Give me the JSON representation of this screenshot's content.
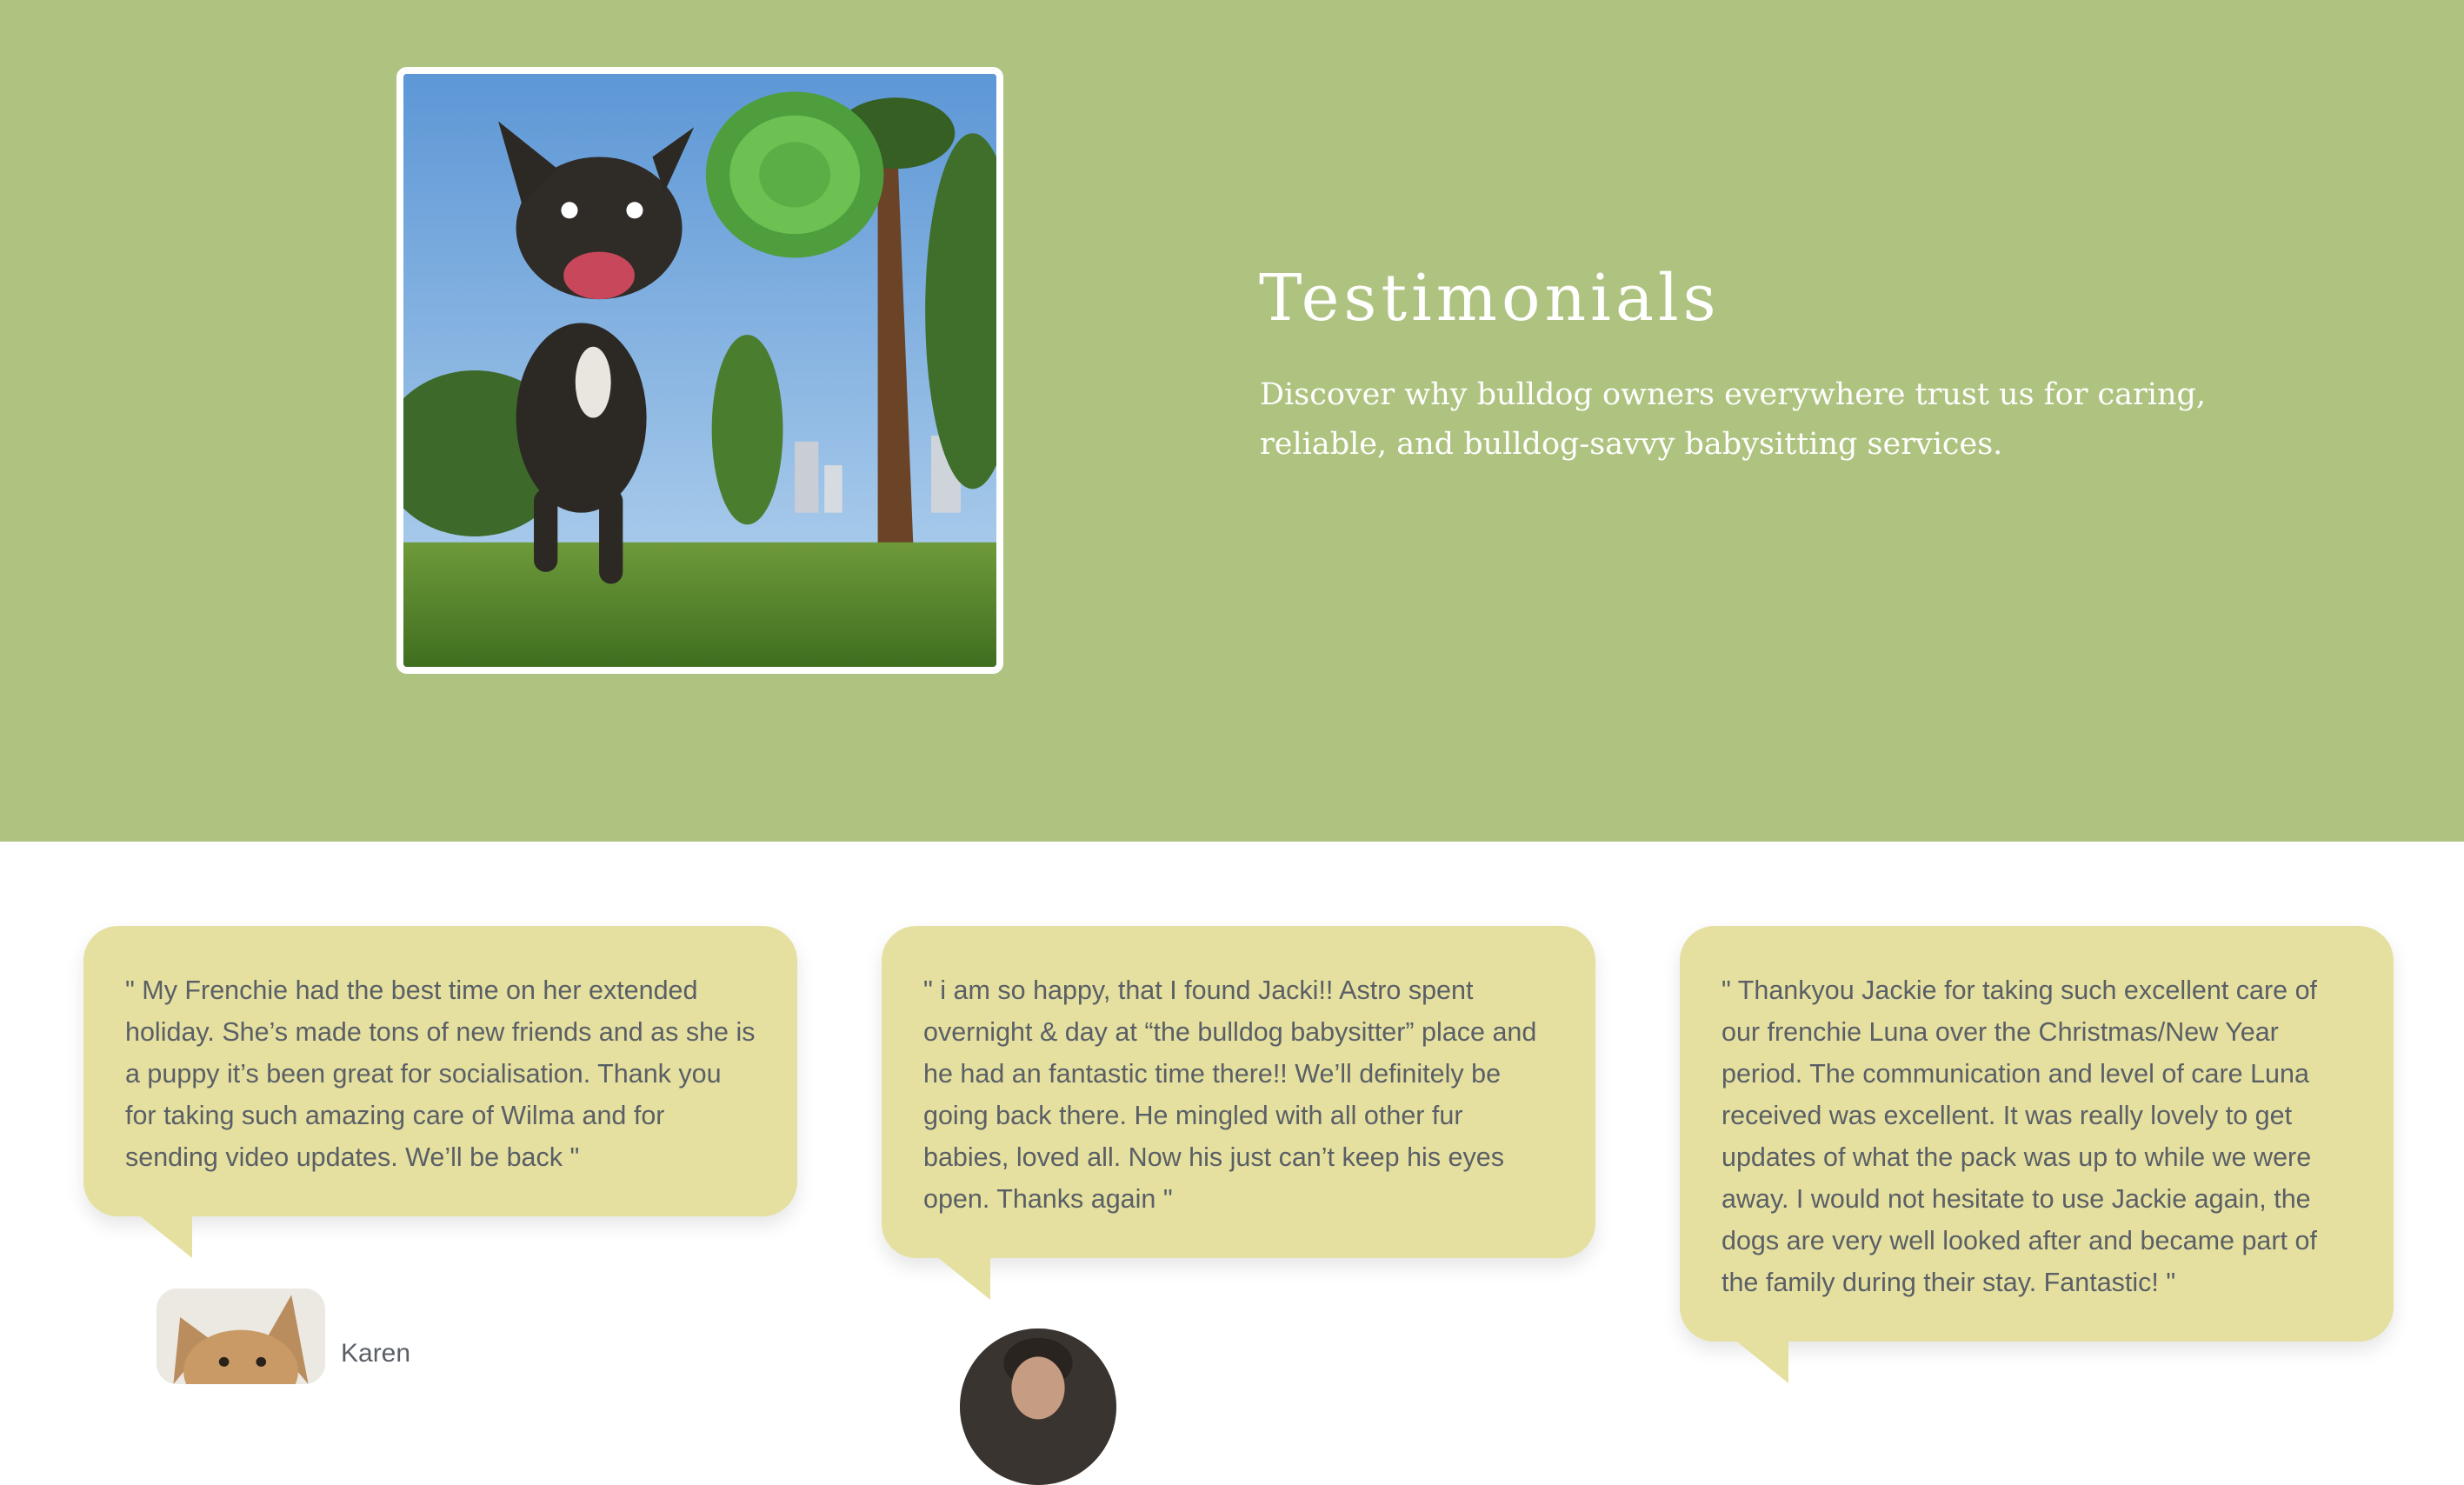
{
  "hero": {
    "title": "Testimonials",
    "subtitle": "Discover why bulldog owners everywhere trust us for caring, reliable, and bulldog-savvy babysitting services.",
    "image": "french-bulldog-catching-frisbee-photo",
    "background_color": "#afc380"
  },
  "testimonials": [
    {
      "quote": "\" My Frenchie had the best time on her extended holiday. She’s made tons of new friends and as she is a puppy it’s been great for socialisation. Thank you for taking such amazing care of Wilma and for sending video updates. We’ll be back \"",
      "author": "Karen",
      "avatar": "french-bulldog-avatar"
    },
    {
      "quote": "\" i am so happy, that I found Jacki!! Astro spent overnight & day at “the bulldog babysitter” place and he had an fantastic time there!! We’ll definitely be going back there. He mingled with all other fur babies, loved all. Now his just can’t keep his eyes open. Thanks again \"",
      "avatar": "person-avatar"
    },
    {
      "quote": "\" Thankyou Jackie for taking such excellent care of our frenchie Luna over the Christmas/New Year period. The communication and level of care Luna received was excellent. It was really lovely to get updates of what the pack was up to while we were away. I would not hesitate to use Jackie again, the dogs are very well looked after and became part of the family during their stay. Fantastic! \""
    }
  ],
  "colors": {
    "card_background": "#e5e09f",
    "card_text": "#5a5f66"
  }
}
